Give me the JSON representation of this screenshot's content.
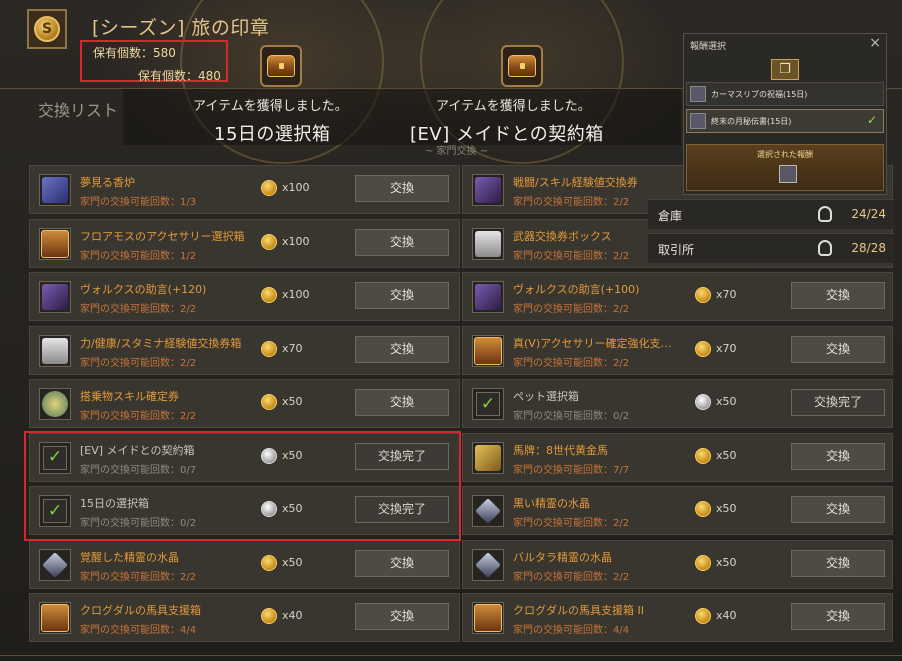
{
  "header": {
    "title": "[シーズン] 旅の印章",
    "owned_1": "保有個数：580",
    "owned_2": "保有個数：480"
  },
  "tab": {
    "label": "交換リスト"
  },
  "notices": [
    {
      "sub": "アイテムを獲得しました。",
      "main": "15日の選択箱"
    },
    {
      "sub": "アイテムを獲得しました。",
      "main": "[EV] メイドとの契約箱"
    }
  ],
  "section_hint": "~ 家門交換 ~",
  "reward_panel": {
    "title": "報酬選択",
    "close": "×",
    "gift_icon": "gift-icon",
    "options": [
      {
        "label": "カーマスリブの祝福(15日)",
        "selected": false
      },
      {
        "label": "終末の月秘伝書(15日)",
        "selected": true
      }
    ],
    "selected_label": "選択された報酬"
  },
  "storage": [
    {
      "label": "倉庫",
      "value": "24/24"
    },
    {
      "label": "取引所",
      "value": "28/28"
    }
  ],
  "colors": {
    "accent_gold": "#e3c48a",
    "item_orange": "#e29a3a",
    "check_green": "#7fd23c",
    "highlight_red": "#d8282c"
  },
  "items_left": [
    {
      "name": "夢見る香炉",
      "count": "家門の交換可能回数：1/3",
      "cost": "x100",
      "coin": "gold",
      "button": "交換",
      "done": false,
      "icon": "incense-icon"
    },
    {
      "name": "フロアモスのアクセサリー選択箱",
      "count": "家門の交換可能回数：1/2",
      "cost": "x100",
      "coin": "gold",
      "button": "交換",
      "done": false,
      "icon": "chest-icon"
    },
    {
      "name": "ヴォルクスの助言(+120)",
      "count": "家門の交換可能回数：2/2",
      "cost": "x100",
      "coin": "gold",
      "button": "交換",
      "done": false,
      "icon": "scroll-icon"
    },
    {
      "name": "力/健康/スタミナ経験値交換券箱",
      "count": "家門の交換可能回数：2/2",
      "cost": "x70",
      "coin": "gold",
      "button": "交換",
      "done": false,
      "icon": "box-icon"
    },
    {
      "name": "搭乗物スキル確定券",
      "count": "家門の交換可能回数：2/2",
      "cost": "x50",
      "coin": "gold",
      "button": "交換",
      "done": false,
      "icon": "compass-icon"
    },
    {
      "name": "[EV] メイドとの契約箱",
      "count": "家門の交換可能回数：0/7",
      "cost": "x50",
      "coin": "silver",
      "button": "交換完了",
      "done": true,
      "icon": "check-icon"
    },
    {
      "name": "15日の選択箱",
      "count": "家門の交換可能回数：0/2",
      "cost": "x50",
      "coin": "silver",
      "button": "交換完了",
      "done": true,
      "icon": "check-icon"
    },
    {
      "name": "覚醒した精霊の水晶",
      "count": "家門の交換可能回数：2/2",
      "cost": "x50",
      "coin": "gold",
      "button": "交換",
      "done": false,
      "icon": "crystal-icon"
    },
    {
      "name": "クログダルの馬具支援箱",
      "count": "家門の交換可能回数：4/4",
      "cost": "x40",
      "coin": "gold",
      "button": "交換",
      "done": false,
      "icon": "chest-icon"
    }
  ],
  "items_right": [
    {
      "name": "戦闘/スキル経験値交換券",
      "count": "家門の交換可能回数：2/2",
      "cost": "",
      "coin": "",
      "button": "",
      "done": false,
      "icon": "scroll-icon"
    },
    {
      "name": "武器交換券ボックス",
      "count": "家門の交換可能回数：2/2",
      "cost": "",
      "coin": "",
      "button": "",
      "done": false,
      "icon": "box-icon"
    },
    {
      "name": "ヴォルクスの助言(+100)",
      "count": "家門の交換可能回数：2/2",
      "cost": "x70",
      "coin": "gold",
      "button": "交換",
      "done": false,
      "icon": "scroll-icon"
    },
    {
      "name": "真(V)アクセサリー確定強化支…",
      "count": "家門の交換可能回数：2/2",
      "cost": "x70",
      "coin": "gold",
      "button": "交換",
      "done": false,
      "icon": "chest-icon"
    },
    {
      "name": "ペット選択箱",
      "count": "家門の交換可能回数：0/2",
      "cost": "x50",
      "coin": "silver",
      "button": "交換完了",
      "done": true,
      "icon": "check-icon"
    },
    {
      "name": "馬牌：8世代黄金馬",
      "count": "家門の交換可能回数：7/7",
      "cost": "x50",
      "coin": "gold",
      "button": "交換",
      "done": false,
      "icon": "horse-icon"
    },
    {
      "name": "黒い精霊の水晶",
      "count": "家門の交換可能回数：2/2",
      "cost": "x50",
      "coin": "gold",
      "button": "交換",
      "done": false,
      "icon": "crystal-icon"
    },
    {
      "name": "バルタラ精霊の水晶",
      "count": "家門の交換可能回数：2/2",
      "cost": "x50",
      "coin": "gold",
      "button": "交換",
      "done": false,
      "icon": "crystal-icon"
    },
    {
      "name": "クログダルの馬具支援箱 II",
      "count": "家門の交換可能回数：4/4",
      "cost": "x40",
      "coin": "gold",
      "button": "交換",
      "done": false,
      "icon": "chest-icon"
    }
  ]
}
